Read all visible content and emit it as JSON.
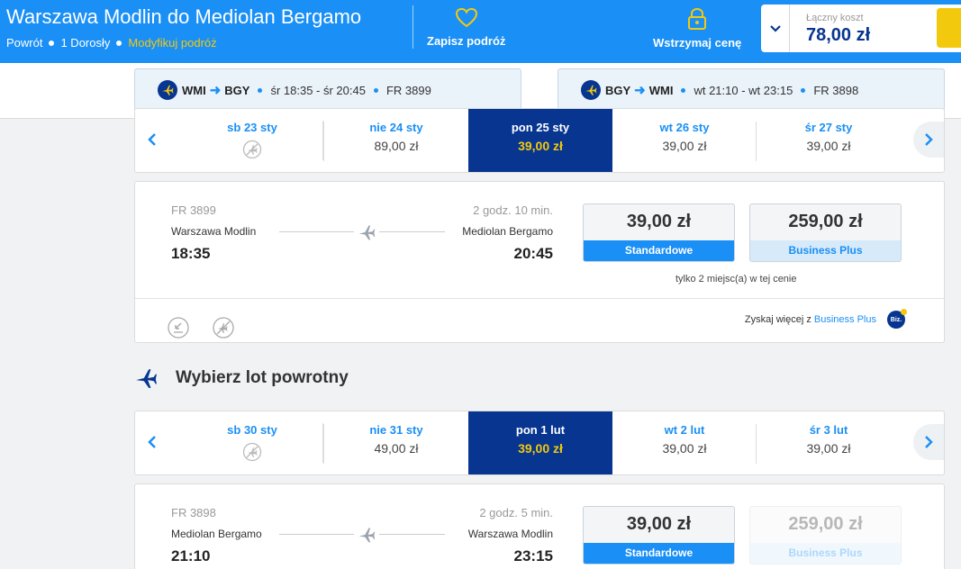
{
  "header": {
    "title": "Warszawa Modlin do Mediolan Bergamo",
    "trip_type": "Powrót",
    "passengers": "1 Dorosły",
    "modify": "Modyfikuj podróż",
    "save_trip": "Zapisz podróż",
    "hold_price": "Wstrzymaj cenę",
    "total_label": "Łączny koszt",
    "total_value": "78,00 zł"
  },
  "summary": {
    "outbound": {
      "from": "WMI",
      "to": "BGY",
      "times": "śr 18:35 - śr 20:45",
      "flight": "FR 3899"
    },
    "inbound": {
      "from": "BGY",
      "to": "WMI",
      "times": "wt 21:10 - wt 23:15",
      "flight": "FR 3898"
    }
  },
  "outbound_dates": [
    {
      "label": "sb 23 sty",
      "price": null,
      "selected": false
    },
    {
      "label": "nie 24 sty",
      "price": "89,00 zł",
      "selected": false
    },
    {
      "label": "pon 25 sty",
      "price": "39,00 zł",
      "selected": true
    },
    {
      "label": "wt 26 sty",
      "price": "39,00 zł",
      "selected": false
    },
    {
      "label": "śr 27 sty",
      "price": "39,00 zł",
      "selected": false
    }
  ],
  "outbound_flight": {
    "number": "FR 3899",
    "duration": "2 godz. 10 min.",
    "from": "Warszawa Modlin",
    "to": "Mediolan Bergamo",
    "dep": "18:35",
    "arr": "20:45",
    "fare_std_price": "39,00 zł",
    "fare_std_name": "Standardowe",
    "fare_biz_price": "259,00 zł",
    "fare_biz_name": "Business Plus",
    "seats_note": "tylko 2 miejsc(a) w tej cenie",
    "upsell_text": "Zyskaj więcej z",
    "upsell_link": "Business Plus",
    "badge": "Biz."
  },
  "return_section": {
    "title": "Wybierz lot powrotny"
  },
  "return_dates": [
    {
      "label": "sb 30 sty",
      "price": null,
      "selected": false
    },
    {
      "label": "nie 31 sty",
      "price": "49,00 zł",
      "selected": false
    },
    {
      "label": "pon 1 lut",
      "price": "39,00 zł",
      "selected": true
    },
    {
      "label": "wt 2 lut",
      "price": "39,00 zł",
      "selected": false
    },
    {
      "label": "śr 3 lut",
      "price": "39,00 zł",
      "selected": false
    }
  ],
  "return_flight": {
    "number": "FR 3898",
    "duration": "2 godz. 5 min.",
    "from": "Mediolan Bergamo",
    "to": "Warszawa Modlin",
    "dep": "21:10",
    "arr": "23:15",
    "fare_std_price": "39,00 zł",
    "fare_std_name": "Standardowe",
    "fare_biz_price": "259,00 zł",
    "fare_biz_name": "Business Plus"
  },
  "colors": {
    "header_blue": "#1a8ff5",
    "navy": "#073590",
    "yellow": "#f3c90d"
  }
}
